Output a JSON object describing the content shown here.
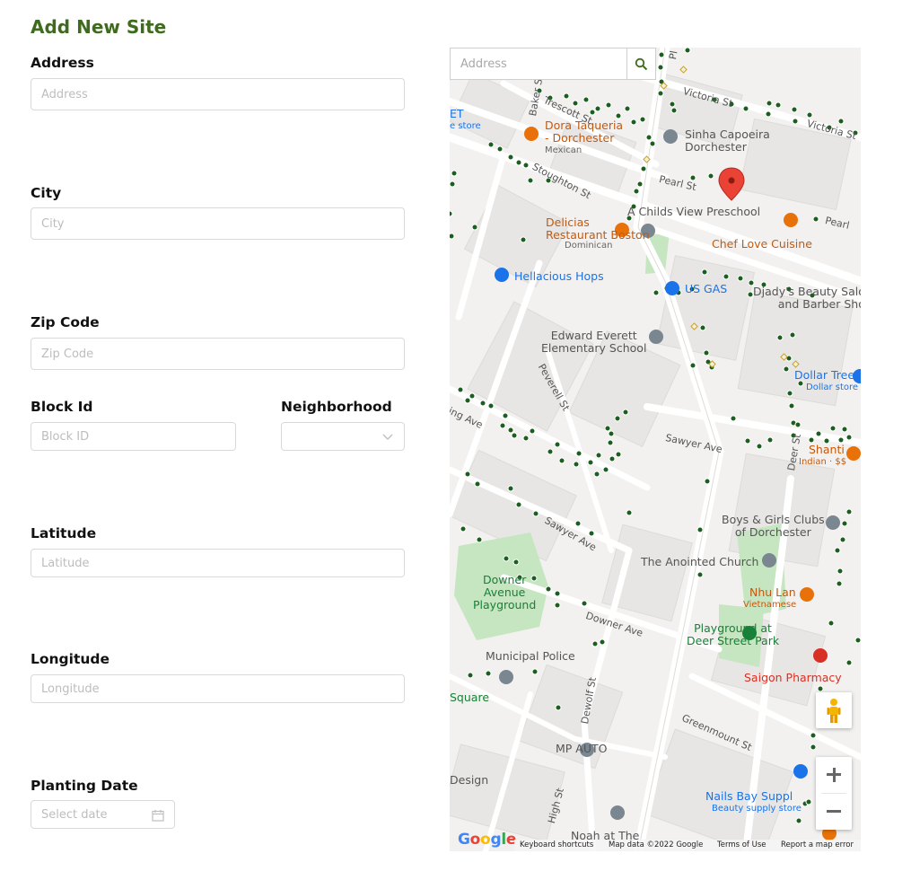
{
  "page": {
    "title": "Add New Site"
  },
  "form": {
    "address": {
      "label": "Address",
      "placeholder": "Address",
      "value": ""
    },
    "city": {
      "label": "City",
      "placeholder": "City",
      "value": ""
    },
    "zip": {
      "label": "Zip Code",
      "placeholder": "Zip Code",
      "value": ""
    },
    "block_id": {
      "label": "Block Id",
      "placeholder": "Block ID",
      "value": ""
    },
    "neighborhood": {
      "label": "Neighborhood",
      "value": ""
    },
    "latitude": {
      "label": "Latitude",
      "placeholder": "Latitude",
      "value": ""
    },
    "longitude": {
      "label": "Longitude",
      "placeholder": "Longitude",
      "value": ""
    },
    "planting_date": {
      "label": "Planting Date",
      "placeholder": "Select date"
    }
  },
  "map": {
    "search_placeholder": "Address",
    "pois": {
      "dora": "Dora Taqueria\n- Dorchester",
      "dora_sub": "Mexican",
      "sinha": "Sinha Capoeira\nDorchester",
      "delicias": "Delicias\nRestaurant Boston",
      "delicias_sub": "Dominican",
      "childs": "A Childs View Preschool",
      "chef": "Chef Love Cuisine",
      "hellacious": "Hellacious Hops",
      "usgas": "US GAS",
      "djady": "Djady's Beauty Salo\nand Barber Sho",
      "edward": "Edward Everett\nElementary School",
      "dollar": "Dollar Tree",
      "dollar_sub": "Dollar store",
      "shanti": "Shanti",
      "shanti_sub": "Indian · $$",
      "boys": "Boys & Girls Clubs\nof Dorchester",
      "anointed": "The Anointed Church",
      "nhulan": "Nhu Lan",
      "nhulan_sub": "Vietnamese",
      "downer": "Downer\nAvenue\nPlayground",
      "playground": "Playground at\nDeer Street Park",
      "police": "Municipal Police",
      "saigon": "Saigon Pharmacy",
      "mpauto": "MP AUTO",
      "nails": "Nails Bay Suppl",
      "nails_sub": "Beauty supply store",
      "noah": "Noah at The",
      "square": "Square",
      "design": "Design",
      "et": "ET",
      "store": "e store"
    },
    "streets": {
      "victoria": "Victoria St",
      "victoria2": "Victoria St",
      "trescott": "Trescott St",
      "stoughton": "Stoughton St",
      "pearl": "Pearl St",
      "pearl2": "Pearl",
      "peverell": "Peverell St",
      "sawyer": "Sawyer Ave",
      "sawyer2": "Sawyer Ave",
      "deer": "Deer St",
      "downer": "Downer Ave",
      "greenmount": "Greenmount St",
      "dewolf": "Dewolf St",
      "high": "High St",
      "baker": "Baker St",
      "pl": "Pl",
      "ing": "ing Ave"
    },
    "footer": {
      "shortcuts": "Keyboard shortcuts",
      "mapdata": "Map data ©2022 Google",
      "terms": "Terms of Use",
      "report": "Report a map error"
    },
    "colors": {
      "road": "#ffffff",
      "building": "#e8e8e8",
      "park": "#c9e8c4",
      "marker": "#ea4335",
      "tree_dot": "#1b5e20",
      "poi_orange": "#e8710a",
      "poi_gray": "#7a8690",
      "poi_blue": "#1a73e8",
      "poi_green": "#188038",
      "poi_red": "#d93025"
    }
  }
}
